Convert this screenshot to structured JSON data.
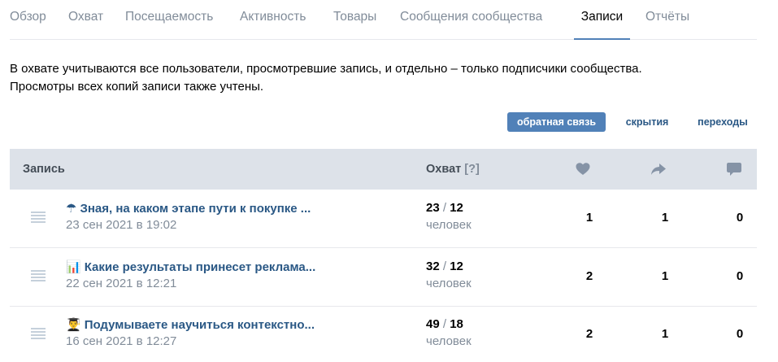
{
  "tabs": [
    {
      "label": "Обзор"
    },
    {
      "label": "Охват"
    },
    {
      "label": "Посещаемость"
    },
    {
      "label": "Активность"
    },
    {
      "label": "Товары"
    },
    {
      "label": "Сообщения сообщества"
    },
    {
      "label": "Записи"
    },
    {
      "label": "Отчёты"
    }
  ],
  "active_tab": "Записи",
  "info": {
    "line1": "В охвате учитываются все пользователи, просмотревшие запись, и отдельно – только подписчики сообщества.",
    "line2": "Просмотры всех копий записи также учтены."
  },
  "filters": [
    {
      "label": "обратная связь",
      "active": true
    },
    {
      "label": "скрытия",
      "active": false
    },
    {
      "label": "переходы",
      "active": false
    }
  ],
  "table": {
    "col_post": "Запись",
    "col_reach": "Охват",
    "col_reach_help": "[?]",
    "icons": [
      "heart-icon",
      "share-icon",
      "comment-icon"
    ],
    "rows": [
      {
        "emoji": "☂",
        "title": "Зная, на каком этапе пути к покупке ...",
        "date": "23 сен 2021 в 19:02",
        "reach": "23",
        "reach_sep": "/",
        "subs": "12",
        "people": "человек",
        "likes": "1",
        "shares": "1",
        "comments": "0"
      },
      {
        "emoji": "📊",
        "title": "Какие результаты принесет реклама...",
        "date": "22 сен 2021 в 12:21",
        "reach": "32",
        "reach_sep": "/",
        "subs": "12",
        "people": "человек",
        "likes": "2",
        "shares": "1",
        "comments": "0"
      },
      {
        "emoji": "👨‍🎓",
        "title": "Подумываете научиться контекстно...",
        "date": "16 сен 2021 в 12:27",
        "reach": "49",
        "reach_sep": "/",
        "subs": "18",
        "people": "человек",
        "likes": "2",
        "shares": "1",
        "comments": "0"
      }
    ]
  },
  "colors": {
    "accent": "#5181b8",
    "link": "#2a5885",
    "muted": "#818c99",
    "header_bg": "#dde2e9"
  }
}
